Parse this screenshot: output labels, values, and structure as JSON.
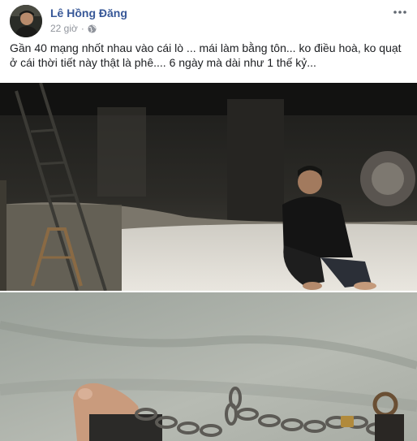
{
  "post": {
    "author": "Lê Hồng Đăng",
    "time": "22 giờ",
    "privacy_icon": "globe-icon",
    "more_icon": "more-options-icon",
    "text_line1": "Gần 40 mạng nhốt nhau vào cái lò ... mái làm bằng tôn... ko điều hoà, ko quạt",
    "text_line2": "ở cái thời tiết này thật là phê.... 6 ngày mà dài như 1 thế kỷ..."
  },
  "colors": {
    "author": "#385898",
    "meta": "#90949c",
    "text": "#1c1e21"
  }
}
